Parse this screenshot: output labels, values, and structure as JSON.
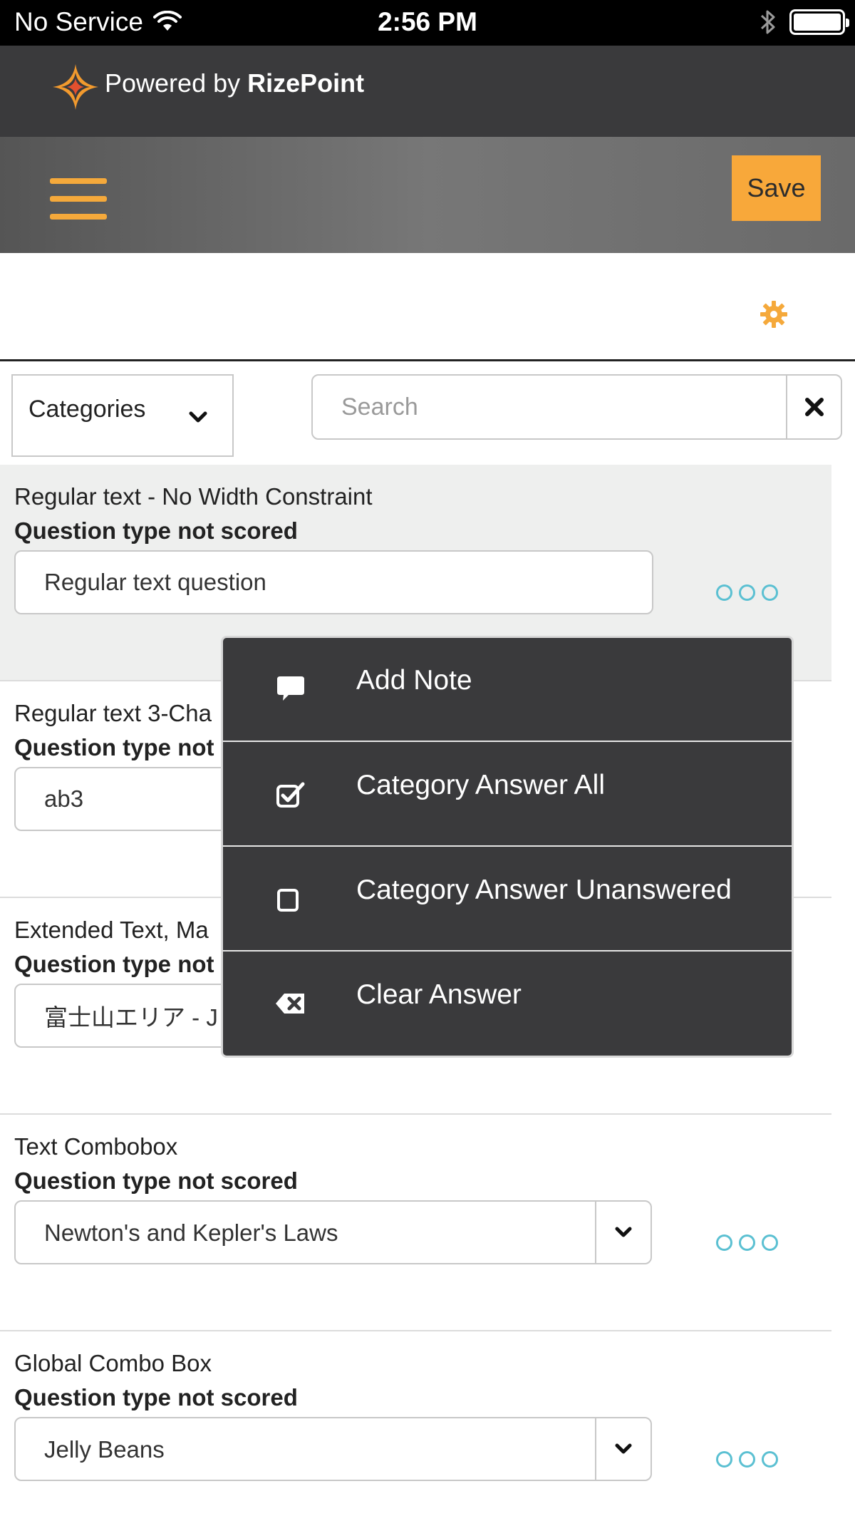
{
  "status_bar": {
    "carrier": "No Service",
    "time": "2:56 PM"
  },
  "brand": {
    "prefix": "Powered by",
    "name": "RizePoint"
  },
  "toolbar": {
    "save_label": "Save"
  },
  "filters": {
    "categories_label": "Categories",
    "search_placeholder": "Search"
  },
  "questions": [
    {
      "title": "Regular text - No Width Constraint",
      "subtitle": "Question type not scored",
      "value": "Regular text question",
      "kind": "text"
    },
    {
      "title": "Regular text 3-Cha",
      "subtitle": "Question type not",
      "value": "ab3",
      "kind": "text"
    },
    {
      "title": "Extended Text, Ma",
      "subtitle": "Question type not",
      "value": "富士山エリア - J",
      "kind": "text"
    },
    {
      "title": "Text Combobox",
      "subtitle": "Question type not scored",
      "value": "Newton's and Kepler's Laws",
      "kind": "combo"
    },
    {
      "title": "Global Combo Box",
      "subtitle": "Question type not scored",
      "value": "Jelly Beans",
      "kind": "combo"
    }
  ],
  "popup_menu": {
    "items": [
      {
        "label": "Add Note",
        "icon": "speech-bubble-icon"
      },
      {
        "label": "Category Answer All",
        "icon": "checked-box-icon"
      },
      {
        "label": "Category Answer Unanswered",
        "icon": "empty-box-icon"
      },
      {
        "label": "Clear Answer",
        "icon": "backspace-icon"
      }
    ]
  },
  "colors": {
    "accent": "#f8a83a",
    "more_dots": "#5bc0d2",
    "brand_bar": "#3a3a3c",
    "popup_bg": "#3a3a3c"
  }
}
